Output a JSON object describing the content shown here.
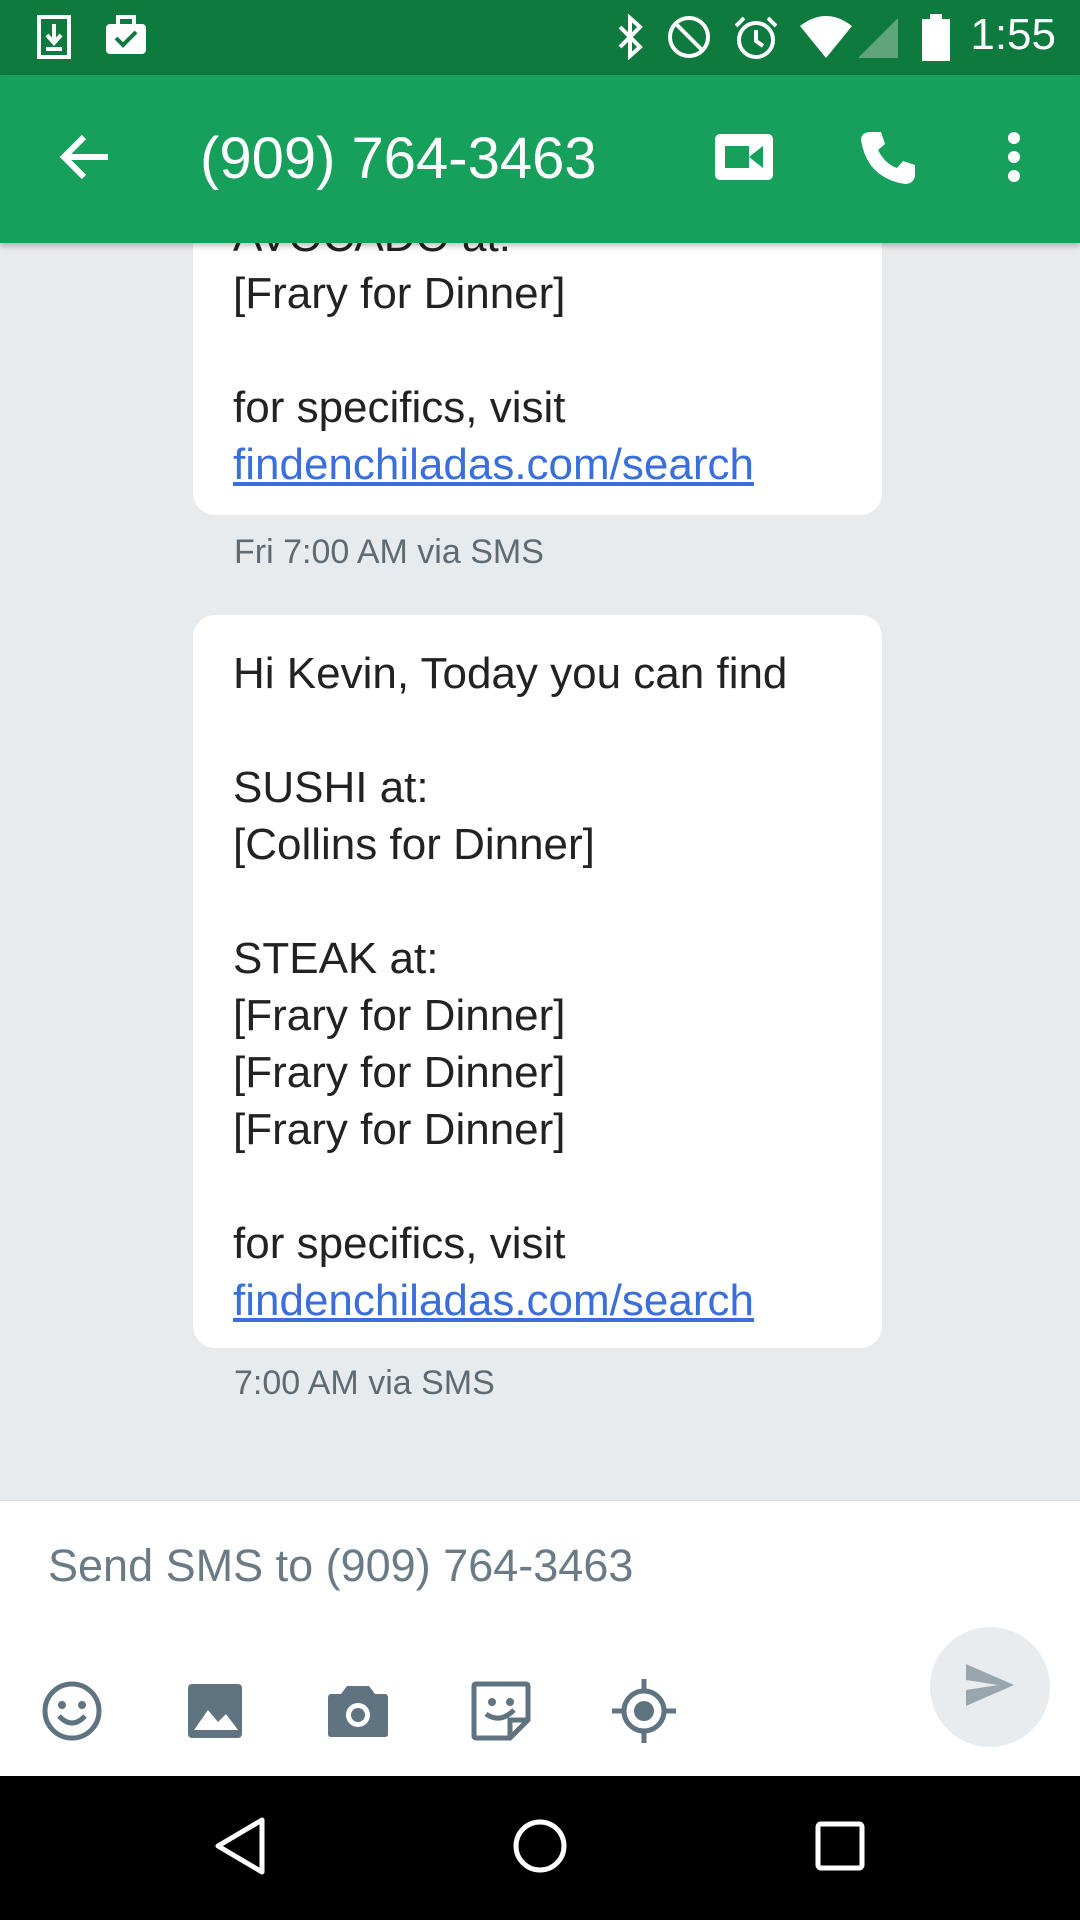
{
  "status_bar": {
    "time": "1:55",
    "icons": [
      "download-icon",
      "briefcase-check-icon",
      "bluetooth-icon",
      "do-not-disturb-icon",
      "alarm-icon",
      "wifi-icon",
      "signal-icon",
      "battery-icon"
    ]
  },
  "app_bar": {
    "title": "(909) 764-3463",
    "icons": [
      "back-arrow-icon",
      "video-call-icon",
      "phone-icon",
      "more-vert-icon"
    ]
  },
  "messages": [
    {
      "lines": [
        "AVOCADO at:",
        "[Frary for Dinner]",
        "",
        "for specifics, visit"
      ],
      "link": "findenchiladas.com/search",
      "meta": "Fri 7:00 AM via SMS"
    },
    {
      "lines": [
        "Hi Kevin, Today you can find",
        "",
        "SUSHI at:",
        "[Collins for Dinner]",
        "",
        "STEAK at:",
        "[Frary for Dinner]",
        "[Frary for Dinner]",
        "[Frary for Dinner]",
        "",
        "for specifics, visit"
      ],
      "link": "findenchiladas.com/search",
      "meta": "7:00 AM via SMS"
    }
  ],
  "compose": {
    "placeholder": "Send SMS to (909) 764-3463",
    "value": "",
    "tools": [
      "emoji-icon",
      "gallery-icon",
      "camera-icon",
      "sticker-icon",
      "location-icon"
    ],
    "send_icon": "send-icon"
  },
  "colors": {
    "status_bar": "#0f7a3d",
    "app_bar": "#16a05b",
    "background": "#e8ebee",
    "link": "#3a6fdb"
  }
}
